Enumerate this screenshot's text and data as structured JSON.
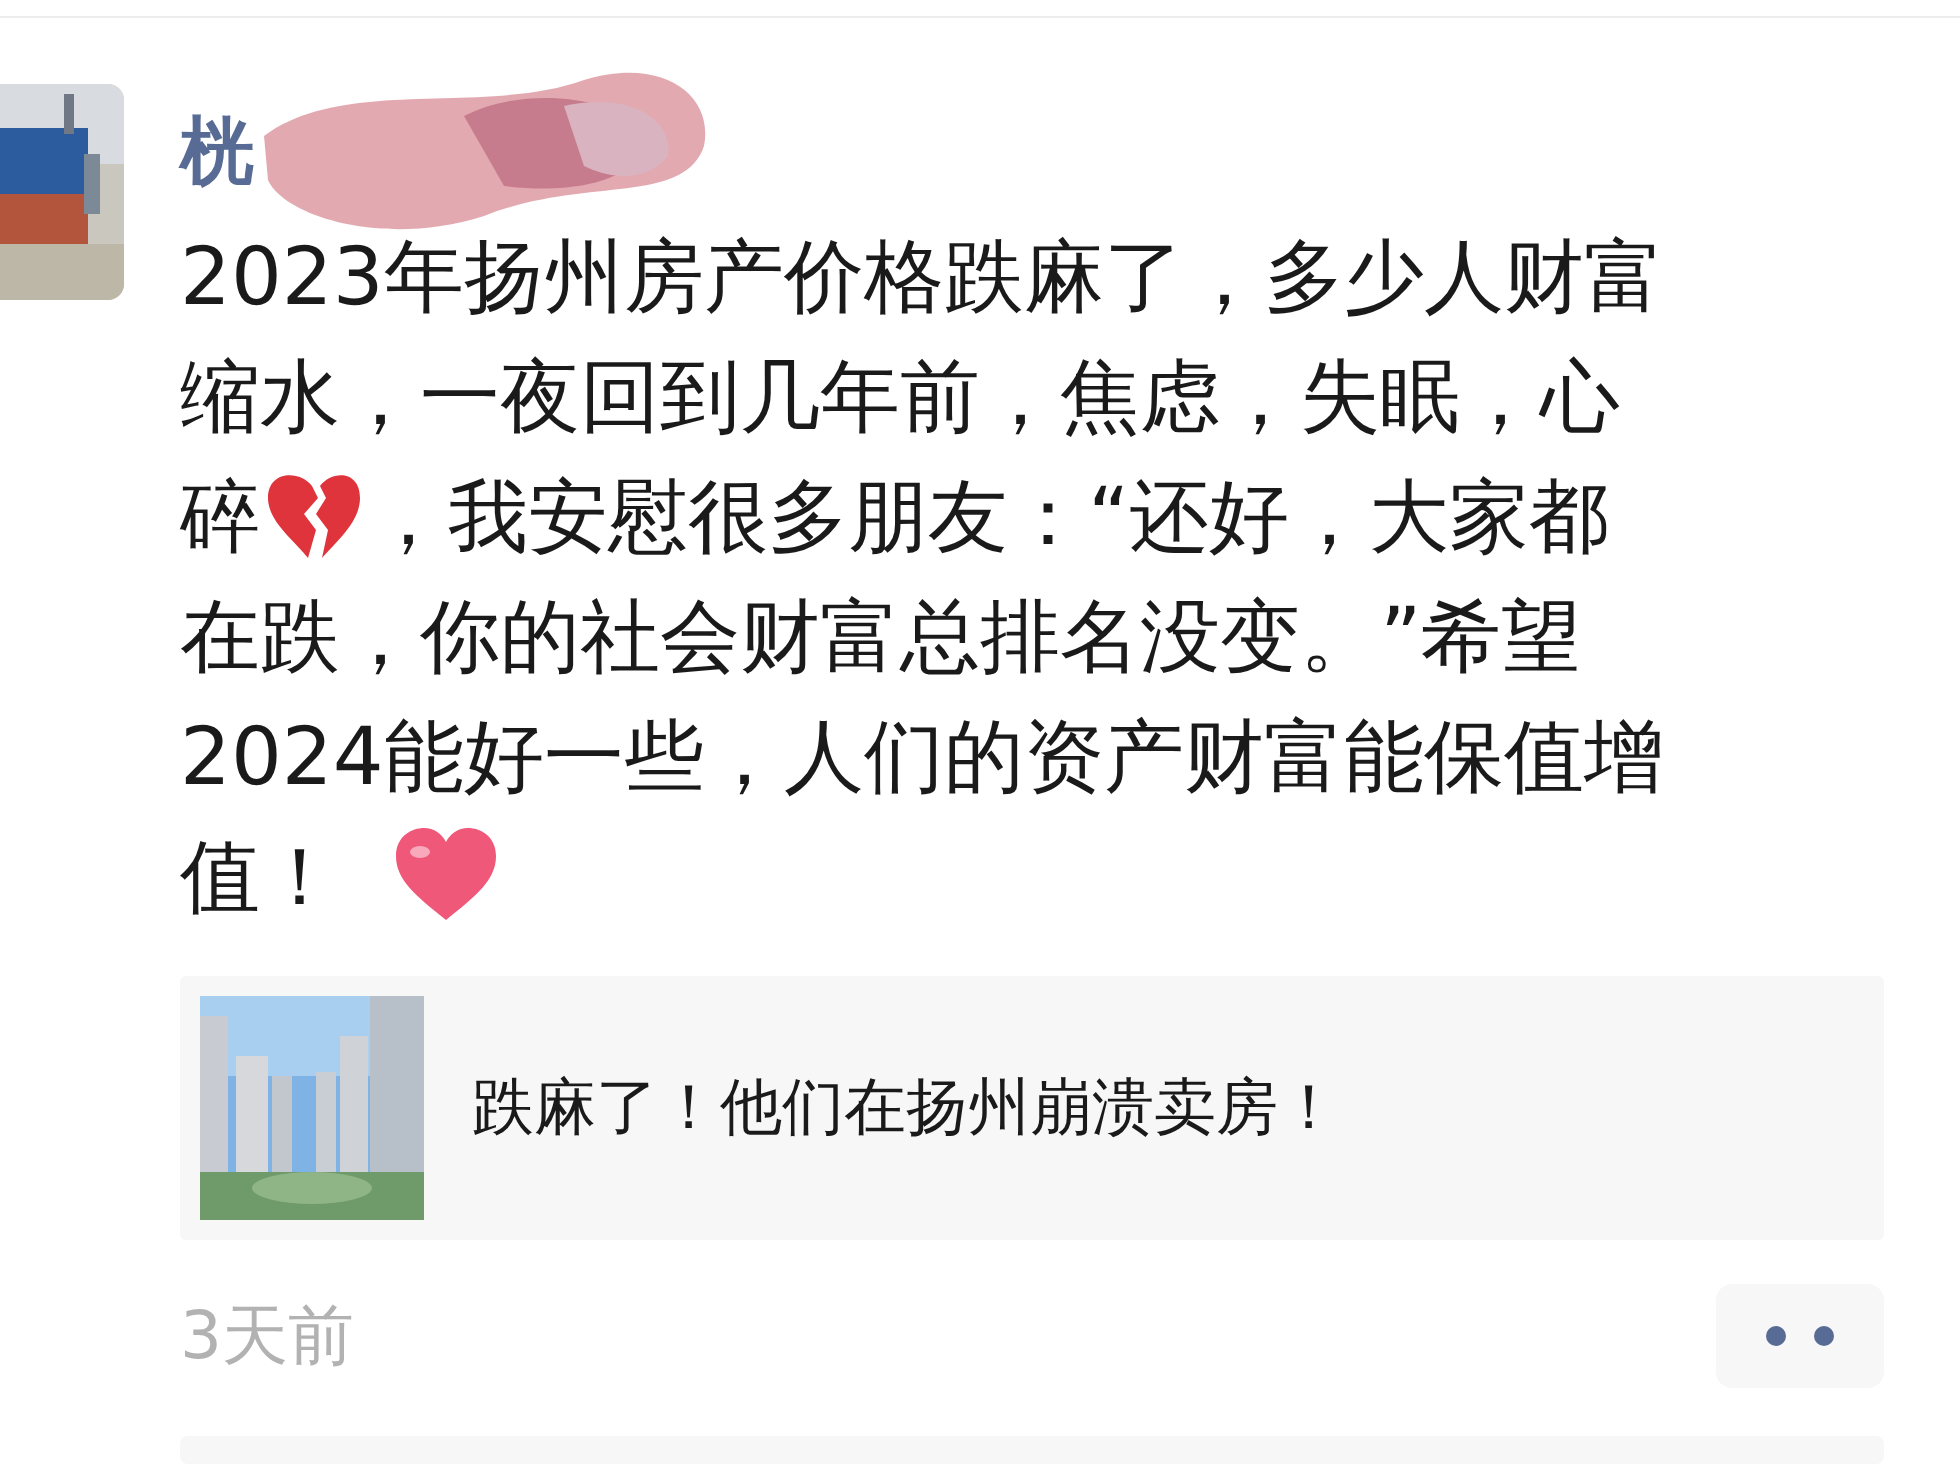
{
  "post": {
    "author": "桄",
    "lines": [
      [
        {
          "kind": "text",
          "text": "2023年扬州房产价格跌麻了，多少人财富"
        }
      ],
      [
        {
          "kind": "text",
          "text": "缩水，一夜回到几年前，焦虑，失眠，心"
        }
      ],
      [
        {
          "kind": "text",
          "text": "碎"
        },
        {
          "kind": "broken_heart"
        },
        {
          "kind": "text",
          "text": "，我安慰很多朋友：“还好，大家都"
        }
      ],
      [
        {
          "kind": "text",
          "text": "在跌，你的社会财富总排名没变。”希望"
        }
      ],
      [
        {
          "kind": "text",
          "text": "2024能好一些，人们的资产财富能保值增"
        }
      ],
      [
        {
          "kind": "text",
          "text": "值！"
        },
        {
          "kind": "heart"
        }
      ]
    ],
    "link": {
      "title": "跌麻了！他们在扬州崩溃卖房！"
    },
    "time": "3天前"
  }
}
